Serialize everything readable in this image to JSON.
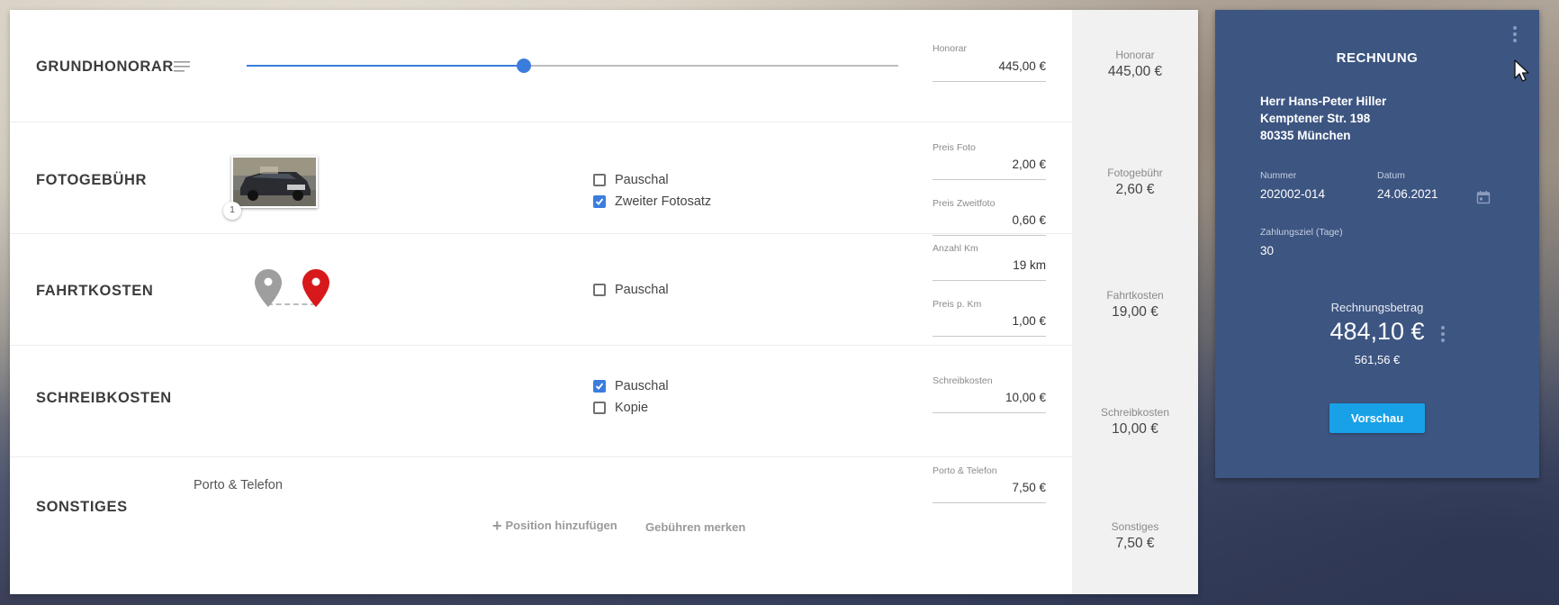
{
  "rows": {
    "grundhonorar": {
      "title": "GRUNDHONORAR",
      "slider_fraction": 0.425,
      "field": {
        "label": "Honorar",
        "value": "445,00 €"
      },
      "summary": {
        "label": "Honorar",
        "value": "445,00 €"
      }
    },
    "fotogebuehr": {
      "title": "FOTOGEBÜHR",
      "photo_count": "1",
      "checkboxes": [
        {
          "label": "Pauschal",
          "checked": false
        },
        {
          "label": "Zweiter Fotosatz",
          "checked": true
        }
      ],
      "fields": [
        {
          "label": "Preis Foto",
          "value": "2,00 €"
        },
        {
          "label": "Preis Zweitfoto",
          "value": "0,60 €"
        }
      ],
      "summary": {
        "label": "Fotogebühr",
        "value": "2,60 €"
      }
    },
    "fahrtkosten": {
      "title": "FAHRTKOSTEN",
      "checkboxes": [
        {
          "label": "Pauschal",
          "checked": false
        }
      ],
      "fields": [
        {
          "label": "Anzahl Km",
          "value": "19 km"
        },
        {
          "label": "Preis p. Km",
          "value": "1,00 €"
        }
      ],
      "summary": {
        "label": "Fahrtkosten",
        "value": "19,00 €"
      }
    },
    "schreibkosten": {
      "title": "SCHREIBKOSTEN",
      "checkboxes": [
        {
          "label": "Pauschal",
          "checked": true
        },
        {
          "label": "Kopie",
          "checked": false
        }
      ],
      "field": {
        "label": "Schreibkosten",
        "value": "10,00 €"
      },
      "summary": {
        "label": "Schreibkosten",
        "value": "10,00 €"
      }
    },
    "sonstiges": {
      "title": "SONSTIGES",
      "item_label": "Porto & Telefon",
      "field": {
        "label": "Porto & Telefon",
        "value": "7,50 €"
      },
      "add_position": "Position hinzufügen",
      "remember_fees": "Gebühren merken",
      "summary": {
        "label": "Sonstiges",
        "value": "7,50 €"
      }
    }
  },
  "invoice": {
    "title": "RECHNUNG",
    "address": [
      "Herr Hans-Peter Hiller",
      "Kemptener Str. 198",
      "80335 München"
    ],
    "number_label": "Nummer",
    "number": "202002-014",
    "date_label": "Datum",
    "date": "24.06.2021",
    "payment_term_label": "Zahlungsziel (Tage)",
    "payment_term": "30",
    "amount_label": "Rechnungsbetrag",
    "amount": "484,10 €",
    "gross_amount": "561,56 €",
    "preview_button": "Vorschau"
  },
  "colors": {
    "accent": "#3b7ddd",
    "invoice_bg": "#3d5581",
    "preview_button": "#18a1e6",
    "pin_origin": "#9e9e9e",
    "pin_destination": "#d7191c"
  },
  "icons": {
    "grundhonorar_menu": "menu-lines-icon",
    "origin_pin": "location-pin-icon",
    "destination_pin": "location-pin-icon",
    "calendar": "calendar-icon",
    "kebab": "more-vert-icon",
    "add": "plus-icon"
  }
}
